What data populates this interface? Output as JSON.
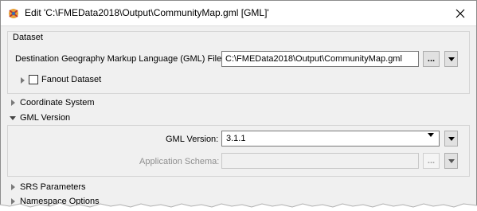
{
  "window": {
    "title": "Edit 'C:\\FMEData2018\\Output\\CommunityMap.gml [GML]'",
    "app_icon": "fme-transformer-icon",
    "close_icon": "close-icon"
  },
  "dataset": {
    "title": "Dataset",
    "destination_label": "Destination Geography Markup Language (GML) File:",
    "destination_value": "C:\\FMEData2018\\Output\\CommunityMap.gml",
    "browse_label": "...",
    "fanout": {
      "label": "Fanout Dataset",
      "checked": false,
      "expanded": false
    }
  },
  "sections": {
    "coordinate_system": {
      "label": "Coordinate System",
      "expanded": false
    },
    "gml_version": {
      "label": "GML Version",
      "expanded": true
    },
    "srs_parameters": {
      "label": "SRS Parameters",
      "expanded": false
    },
    "namespace_options": {
      "label": "Namespace Options",
      "expanded": false
    }
  },
  "gml_version_group": {
    "version_label": "GML Version:",
    "version_value": "3.1.1",
    "schema_label": "Application Schema:",
    "schema_value": "",
    "schema_browse_label": "..."
  },
  "colors": {
    "dialog_background": "#f0f0f0",
    "border": "#d5d5d5"
  }
}
